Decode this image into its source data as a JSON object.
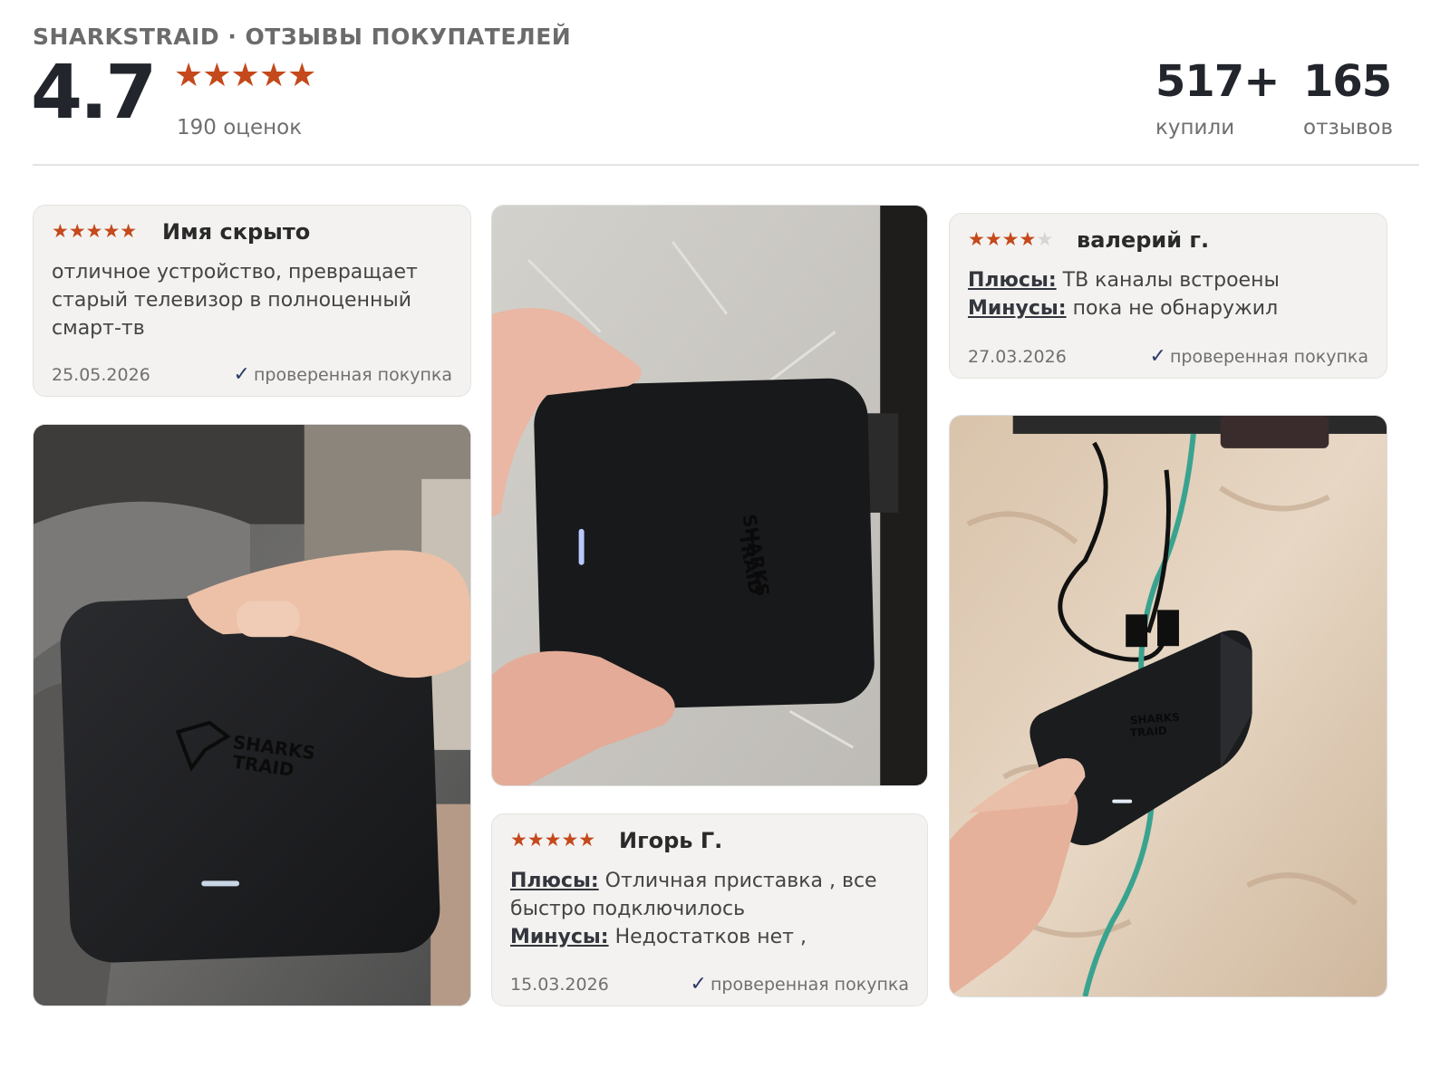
{
  "header": {
    "brand": "SHARKSTRAID · ОТЗЫВЫ ПОКУПАТЕЛЕЙ",
    "rating": "4.7",
    "rating_stars": "★★★★★",
    "ratings_count": "190 оценок",
    "stats": [
      {
        "value": "517+",
        "label": "купили"
      },
      {
        "value": "165",
        "label": "отзывов"
      }
    ]
  },
  "reviews": [
    {
      "stars_on": "★★★★★",
      "stars_off": "",
      "rating": 5,
      "author": "Имя скрыто",
      "text": "отличное устройство, превращает старый телевизор в полноценный смарт-тв",
      "date": "25.05.2026",
      "verified": "проверенная покупка"
    },
    {
      "stars_on": "★★★★",
      "stars_off": "★",
      "rating": 4,
      "author": "валерий г.",
      "pros_label": "Плюсы:",
      "pros": "ТВ каналы встроены",
      "cons_label": "Минусы:",
      "cons": "пока не обнаружил",
      "date": "27.03.2026",
      "verified": "проверенная покупка"
    },
    {
      "stars_on": "★★★★★",
      "stars_off": "",
      "rating": 5,
      "author": "Игорь Г.",
      "pros_label": "Плюсы:",
      "pros": "Отличная приставка , все быстро подключилось",
      "cons_label": "Минусы:",
      "cons": "Недостатков нет ,",
      "date": "15.03.2026",
      "verified": "проверенная покупка"
    }
  ],
  "photos": [
    {
      "name": "photo-device-on-lap",
      "logo": "SHARKS TRAID"
    },
    {
      "name": "photo-device-on-wall",
      "logo": "SHARKS TRAID"
    },
    {
      "name": "photo-device-connected",
      "logo": "SHARKS TRAID"
    }
  ],
  "colors": {
    "star": "#c4491b",
    "card_bg": "#f3f2f0",
    "check": "#2c3b68",
    "device": "#1c1d20"
  }
}
